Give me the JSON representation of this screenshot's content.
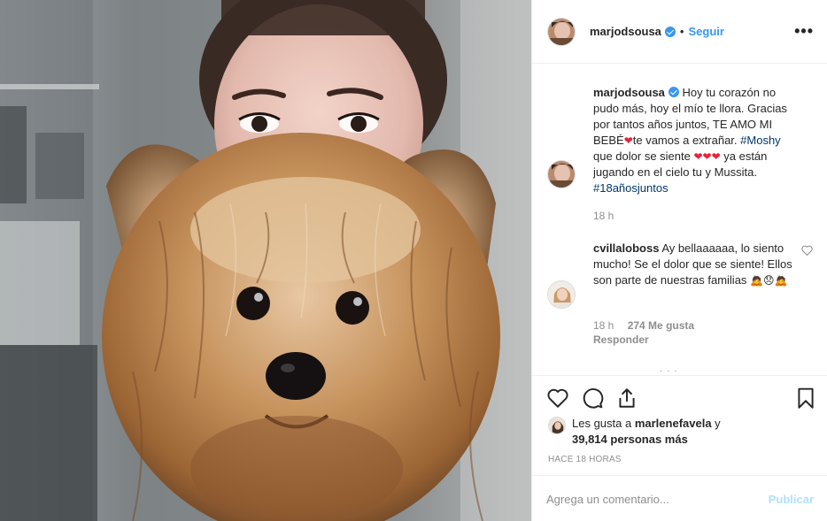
{
  "post": {
    "username": "marjodsousa",
    "follow_label": "Seguir",
    "more_label": "•••"
  },
  "caption": {
    "username": "marjodsousa",
    "text_1": "Hoy tu corazón no pudo más, hoy el mío te llora. Gracias por tantos años juntos, TE AMO MI BEBÉ",
    "text_2": "te vamos a extrañar. ",
    "hashtag_1": "#Moshy",
    "text_3": " que dolor se siente ",
    "text_4": " ya están jugando en el cielo tu y Mussita. ",
    "hashtag_2": "#18añosjuntos",
    "hearts": "❤❤❤",
    "time": "18 h"
  },
  "comments": [
    {
      "username": "cvillaloboss",
      "text": "Ay bellaaaaaa, lo siento mucho! Se el dolor que se siente! Ellos son parte de nuestras familias ",
      "emojis": "🙇😞🙇",
      "time": "18 h",
      "likes": "274 Me gusta",
      "reply_label": "Responder"
    }
  ],
  "actions": {
    "likes_prefix": "Les gusta a ",
    "liker": "marlenefavela",
    "likes_mid": " y",
    "likes_count": "39,814 personas más",
    "time_ago": "HACE 18 HORAS"
  },
  "composer": {
    "placeholder": "Agrega un comentario...",
    "publish_label": "Publicar"
  },
  "colors": {
    "accent": "#3897f0",
    "muted": "#8e8e8e",
    "heart": "#ed1f3a"
  }
}
